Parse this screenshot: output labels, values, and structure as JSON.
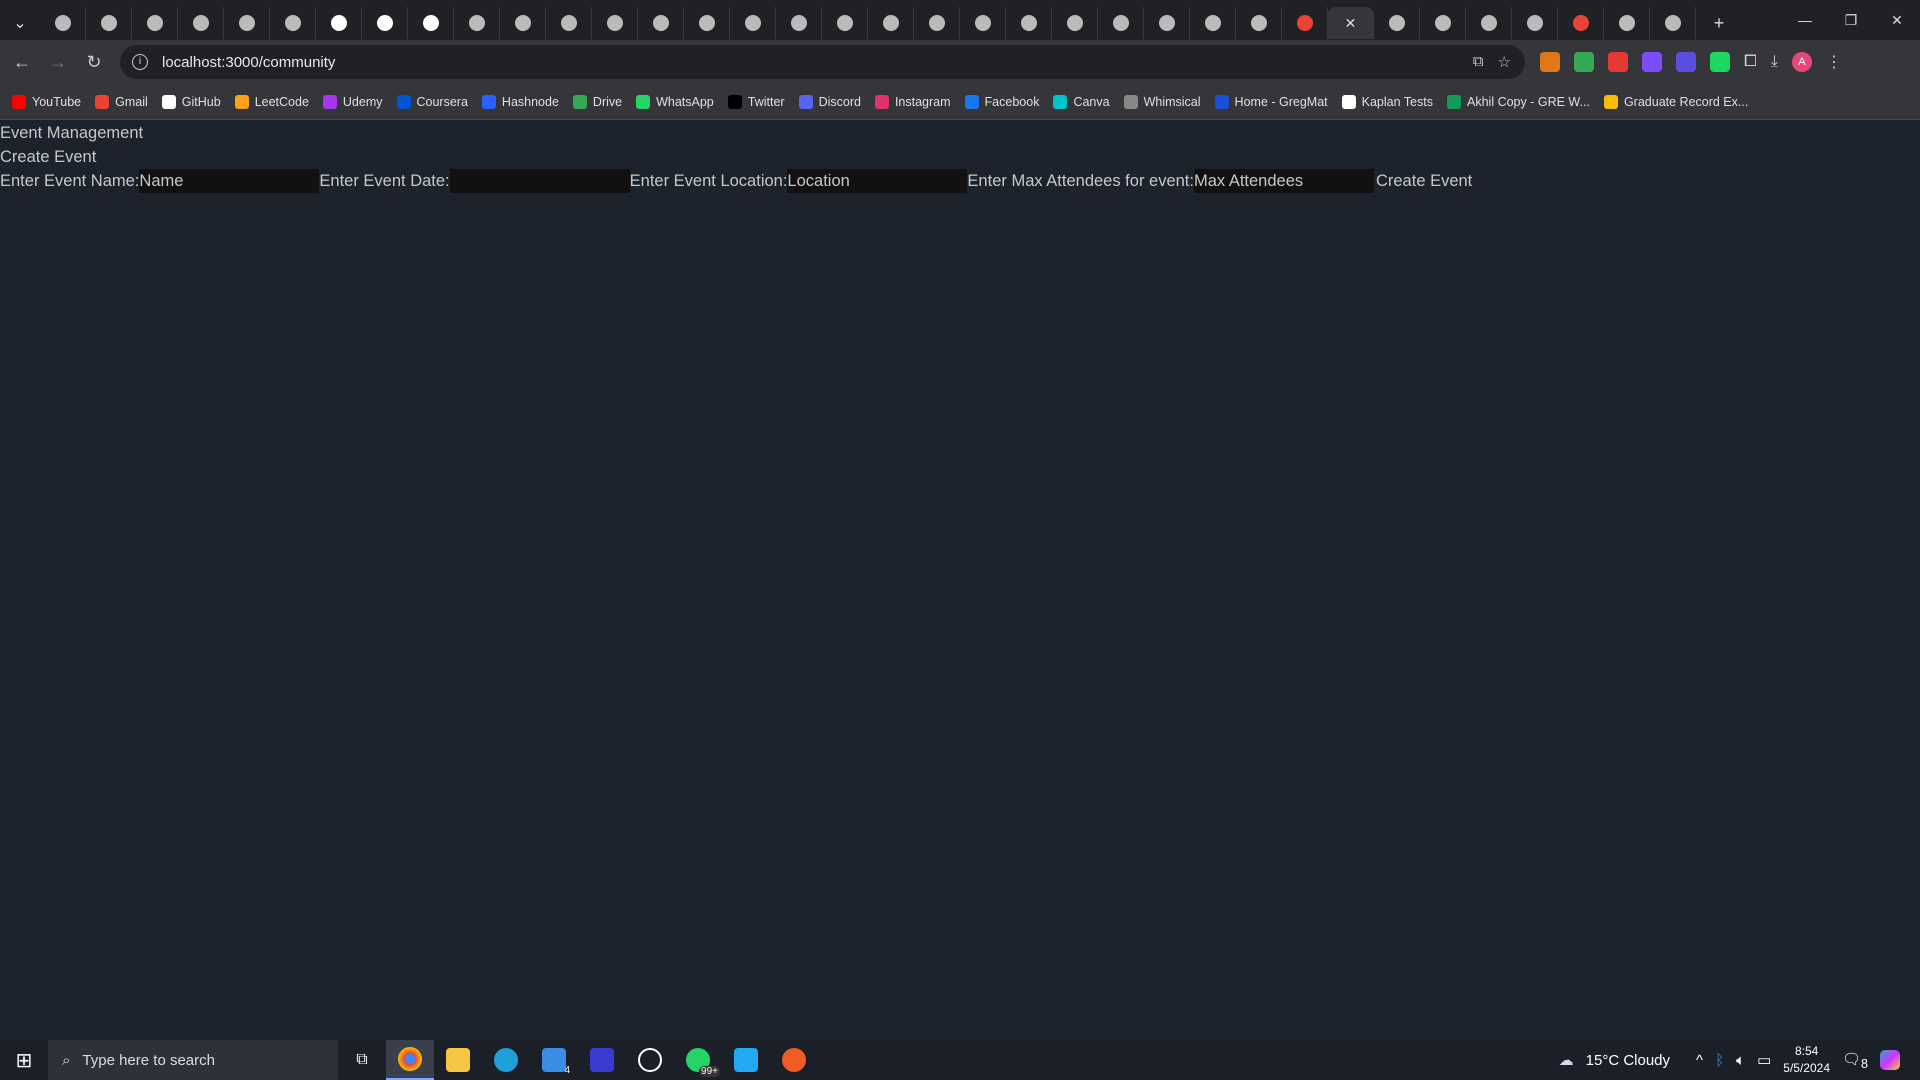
{
  "browser": {
    "tabs": [
      "tab",
      "tab",
      "tab",
      "tab",
      "tab",
      "github",
      "notion",
      "notion",
      "notion",
      "tab",
      "tab",
      "tab",
      "tab",
      "tab",
      "github",
      "tab",
      "tab",
      "github",
      "tab",
      "tab",
      "tab",
      "tab",
      "tab",
      "tab",
      "tab",
      "github",
      "github",
      "gmail",
      "active",
      "tab",
      "github",
      "tab",
      "tab",
      "gmail",
      "tab",
      "tab"
    ],
    "active_tab_close": "✕",
    "new_tab": "+",
    "url": "localhost:3000/community",
    "bookmarks": [
      {
        "label": "YouTube",
        "color": "#ff0000"
      },
      {
        "label": "Gmail",
        "color": "#ea4335"
      },
      {
        "label": "GitHub",
        "color": "#ffffff"
      },
      {
        "label": "LeetCode",
        "color": "#ffa116"
      },
      {
        "label": "Udemy",
        "color": "#a435f0"
      },
      {
        "label": "Coursera",
        "color": "#0056d2"
      },
      {
        "label": "Hashnode",
        "color": "#2962ff"
      },
      {
        "label": "Drive",
        "color": "#34a853"
      },
      {
        "label": "WhatsApp",
        "color": "#25d366"
      },
      {
        "label": "Twitter",
        "color": "#000000"
      },
      {
        "label": "Discord",
        "color": "#5865f2"
      },
      {
        "label": "Instagram",
        "color": "#e1306c"
      },
      {
        "label": "Facebook",
        "color": "#1877f2"
      },
      {
        "label": "Canva",
        "color": "#00c4cc"
      },
      {
        "label": "Whimsical",
        "color": "#888888"
      },
      {
        "label": "Home - GregMat",
        "color": "#1a4fd6"
      },
      {
        "label": "Kaplan Tests",
        "color": "#ffffff"
      },
      {
        "label": "Akhil Copy - GRE W...",
        "color": "#0f9d58"
      },
      {
        "label": "Graduate Record Ex...",
        "color": "#fbbc04"
      }
    ],
    "extension_colors": [
      "#e2761b",
      "#34a853",
      "#e53935",
      "#7c4dff",
      "#5b4de0",
      "#1ed760"
    ],
    "profile_initial": "A"
  },
  "page": {
    "title": "Event Management",
    "section": "Create Event",
    "form": {
      "name_label": "Enter Event Name:",
      "name_placeholder": "Name",
      "date_label": "Enter Event Date:",
      "date_value": "",
      "location_label": "Enter Event Location:",
      "location_placeholder": "Location",
      "max_label": "Enter Max Attendees for event:",
      "max_placeholder": "Max Attendees",
      "submit": "Create Event"
    }
  },
  "taskbar": {
    "search_placeholder": "Type here to search",
    "mail_badge": "4",
    "whatsapp_badge": "99+",
    "weather": "15°C  Cloudy",
    "time": "8:54",
    "date": "5/5/2024",
    "notifications": "8"
  }
}
